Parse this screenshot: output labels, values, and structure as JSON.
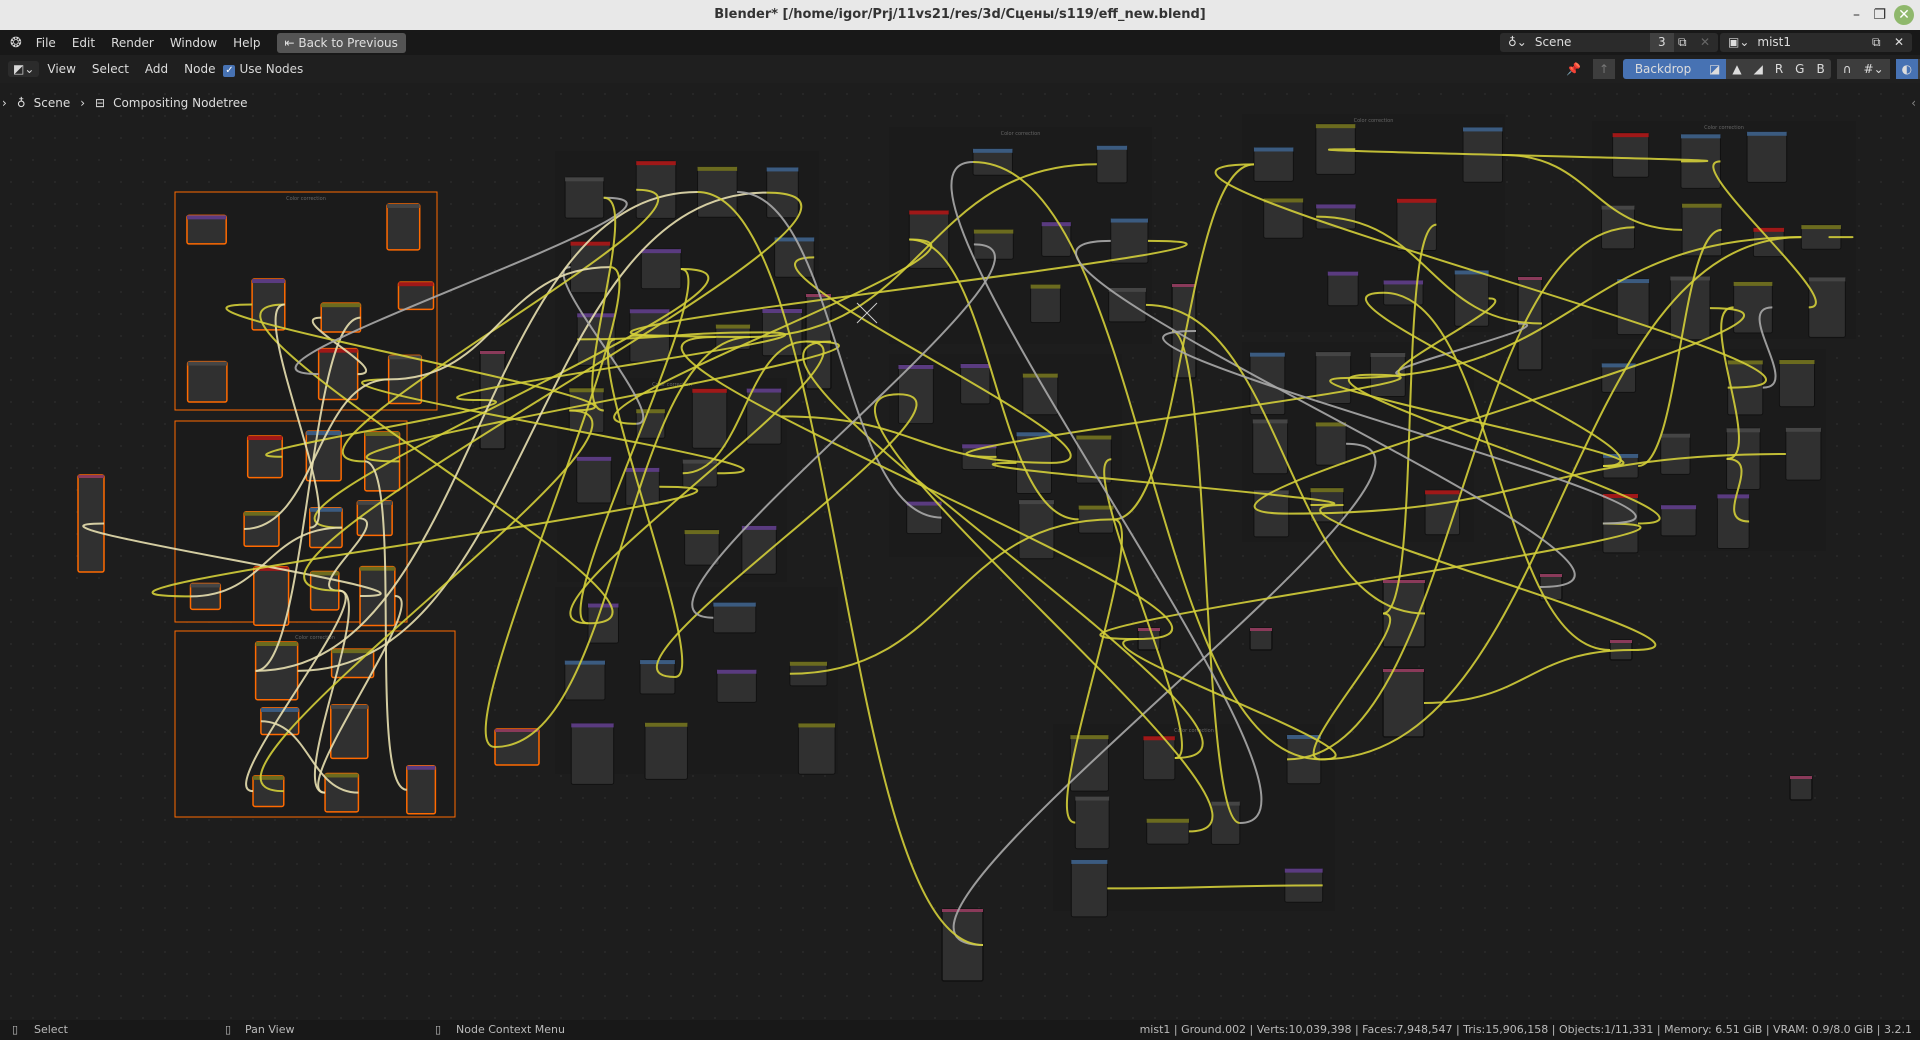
{
  "window": {
    "title": "Blender* [/home/igor/Prj/11vs21/res/3d/Сцены/s119/eff_new.blend]",
    "minimize": "–",
    "maximize": "❐",
    "close": "✕"
  },
  "menu": {
    "items": [
      "File",
      "Edit",
      "Render",
      "Window",
      "Help"
    ],
    "back_button": "Back to Previous"
  },
  "scene_selector": {
    "value": "Scene",
    "users": "3"
  },
  "viewlayer_selector": {
    "value": "mist1"
  },
  "header": {
    "items": [
      "View",
      "Select",
      "Add",
      "Node"
    ],
    "use_nodes_label": "Use Nodes",
    "use_nodes_checked": true,
    "backdrop_label": "Backdrop",
    "channels": [
      "R",
      "G",
      "B"
    ]
  },
  "breadcrumb": {
    "scene": "Scene",
    "tree": "Compositing Nodetree"
  },
  "node_editor": {
    "frame_label": "Color correction",
    "link_color": "#d4cf3a",
    "selected_color": "#ff6a00",
    "frame_color": "#1b1b1b"
  },
  "status": {
    "left": "Select",
    "middle": "Pan View",
    "right": "Node Context Menu",
    "stats": "mist1 | Ground.002 | Verts:10,039,398 | Faces:7,948,547 | Tris:15,906,158 | Objects:1/11,331 | Memory: 6.51 GiB | VRAM: 0.9/8.0 GiB | 3.2.1"
  },
  "colors": {
    "accent": "#4772b3",
    "backdrop_active": "#4772b3"
  }
}
